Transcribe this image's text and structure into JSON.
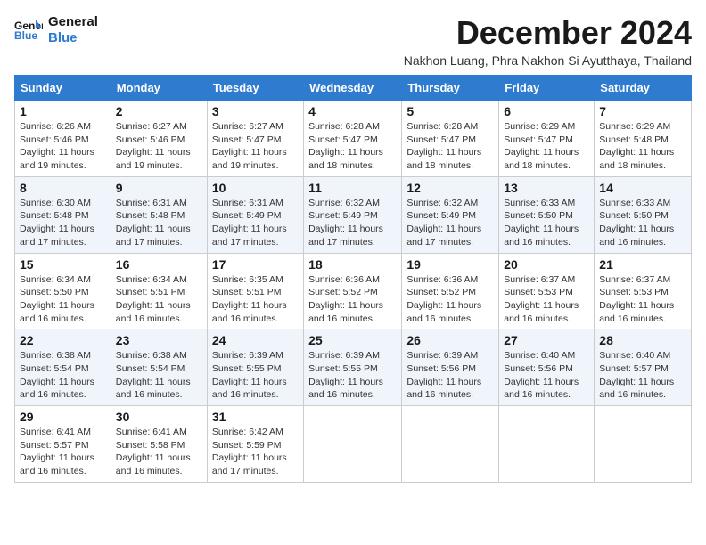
{
  "logo": {
    "line1": "General",
    "line2": "Blue"
  },
  "title": "December 2024",
  "location": "Nakhon Luang, Phra Nakhon Si Ayutthaya, Thailand",
  "days_of_week": [
    "Sunday",
    "Monday",
    "Tuesday",
    "Wednesday",
    "Thursday",
    "Friday",
    "Saturday"
  ],
  "weeks": [
    [
      {
        "day": "1",
        "sunrise": "6:26 AM",
        "sunset": "5:46 PM",
        "daylight": "11 hours and 19 minutes."
      },
      {
        "day": "2",
        "sunrise": "6:27 AM",
        "sunset": "5:46 PM",
        "daylight": "11 hours and 19 minutes."
      },
      {
        "day": "3",
        "sunrise": "6:27 AM",
        "sunset": "5:47 PM",
        "daylight": "11 hours and 19 minutes."
      },
      {
        "day": "4",
        "sunrise": "6:28 AM",
        "sunset": "5:47 PM",
        "daylight": "11 hours and 18 minutes."
      },
      {
        "day": "5",
        "sunrise": "6:28 AM",
        "sunset": "5:47 PM",
        "daylight": "11 hours and 18 minutes."
      },
      {
        "day": "6",
        "sunrise": "6:29 AM",
        "sunset": "5:47 PM",
        "daylight": "11 hours and 18 minutes."
      },
      {
        "day": "7",
        "sunrise": "6:29 AM",
        "sunset": "5:48 PM",
        "daylight": "11 hours and 18 minutes."
      }
    ],
    [
      {
        "day": "8",
        "sunrise": "6:30 AM",
        "sunset": "5:48 PM",
        "daylight": "11 hours and 17 minutes."
      },
      {
        "day": "9",
        "sunrise": "6:31 AM",
        "sunset": "5:48 PM",
        "daylight": "11 hours and 17 minutes."
      },
      {
        "day": "10",
        "sunrise": "6:31 AM",
        "sunset": "5:49 PM",
        "daylight": "11 hours and 17 minutes."
      },
      {
        "day": "11",
        "sunrise": "6:32 AM",
        "sunset": "5:49 PM",
        "daylight": "11 hours and 17 minutes."
      },
      {
        "day": "12",
        "sunrise": "6:32 AM",
        "sunset": "5:49 PM",
        "daylight": "11 hours and 17 minutes."
      },
      {
        "day": "13",
        "sunrise": "6:33 AM",
        "sunset": "5:50 PM",
        "daylight": "11 hours and 16 minutes."
      },
      {
        "day": "14",
        "sunrise": "6:33 AM",
        "sunset": "5:50 PM",
        "daylight": "11 hours and 16 minutes."
      }
    ],
    [
      {
        "day": "15",
        "sunrise": "6:34 AM",
        "sunset": "5:50 PM",
        "daylight": "11 hours and 16 minutes."
      },
      {
        "day": "16",
        "sunrise": "6:34 AM",
        "sunset": "5:51 PM",
        "daylight": "11 hours and 16 minutes."
      },
      {
        "day": "17",
        "sunrise": "6:35 AM",
        "sunset": "5:51 PM",
        "daylight": "11 hours and 16 minutes."
      },
      {
        "day": "18",
        "sunrise": "6:36 AM",
        "sunset": "5:52 PM",
        "daylight": "11 hours and 16 minutes."
      },
      {
        "day": "19",
        "sunrise": "6:36 AM",
        "sunset": "5:52 PM",
        "daylight": "11 hours and 16 minutes."
      },
      {
        "day": "20",
        "sunrise": "6:37 AM",
        "sunset": "5:53 PM",
        "daylight": "11 hours and 16 minutes."
      },
      {
        "day": "21",
        "sunrise": "6:37 AM",
        "sunset": "5:53 PM",
        "daylight": "11 hours and 16 minutes."
      }
    ],
    [
      {
        "day": "22",
        "sunrise": "6:38 AM",
        "sunset": "5:54 PM",
        "daylight": "11 hours and 16 minutes."
      },
      {
        "day": "23",
        "sunrise": "6:38 AM",
        "sunset": "5:54 PM",
        "daylight": "11 hours and 16 minutes."
      },
      {
        "day": "24",
        "sunrise": "6:39 AM",
        "sunset": "5:55 PM",
        "daylight": "11 hours and 16 minutes."
      },
      {
        "day": "25",
        "sunrise": "6:39 AM",
        "sunset": "5:55 PM",
        "daylight": "11 hours and 16 minutes."
      },
      {
        "day": "26",
        "sunrise": "6:39 AM",
        "sunset": "5:56 PM",
        "daylight": "11 hours and 16 minutes."
      },
      {
        "day": "27",
        "sunrise": "6:40 AM",
        "sunset": "5:56 PM",
        "daylight": "11 hours and 16 minutes."
      },
      {
        "day": "28",
        "sunrise": "6:40 AM",
        "sunset": "5:57 PM",
        "daylight": "11 hours and 16 minutes."
      }
    ],
    [
      {
        "day": "29",
        "sunrise": "6:41 AM",
        "sunset": "5:57 PM",
        "daylight": "11 hours and 16 minutes."
      },
      {
        "day": "30",
        "sunrise": "6:41 AM",
        "sunset": "5:58 PM",
        "daylight": "11 hours and 16 minutes."
      },
      {
        "day": "31",
        "sunrise": "6:42 AM",
        "sunset": "5:59 PM",
        "daylight": "11 hours and 17 minutes."
      },
      null,
      null,
      null,
      null
    ]
  ]
}
